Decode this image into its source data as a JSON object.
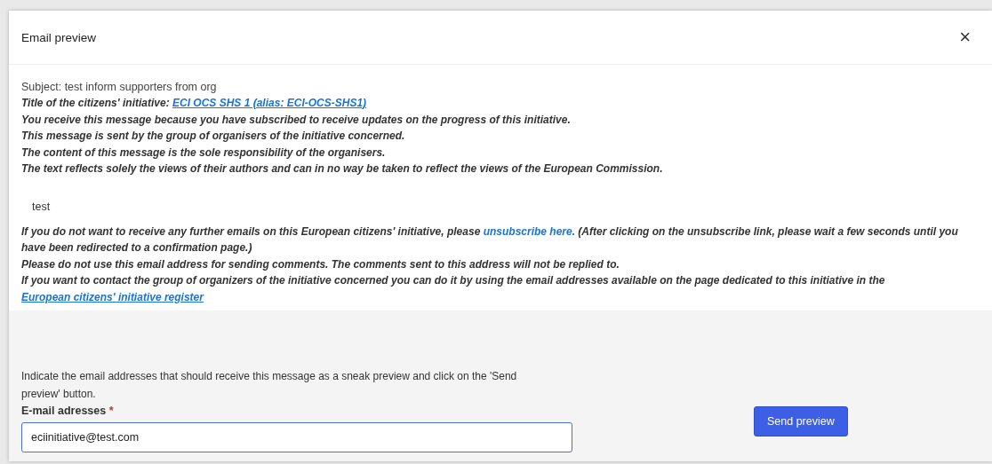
{
  "dialog": {
    "title": "Email preview",
    "close_icon": "×",
    "subject": "Subject: test inform supporters from org",
    "header_lines": [
      {
        "kind": "link",
        "text": "Title of the citizens' initiative: ",
        "link": "ECI OCS SHS 1 (alias: ECI-OCS-SHS1)",
        "underlined": true
      },
      {
        "kind": "text",
        "text": "You receive this message because you have subscribed to receive updates on the progress of this initiative."
      },
      {
        "kind": "text",
        "text": "This message is sent by the group of organisers of the initiative concerned."
      },
      {
        "kind": "text",
        "text": "The content of this message is the sole responsibility of the organisers."
      },
      {
        "kind": "text",
        "text": "The text reflects solely the views of their authors and can in no way be taken to reflect the views of the European Commission."
      }
    ],
    "body": "test",
    "footer_lines": [
      {
        "kind": "link",
        "text": "If you do not want to receive any further emails on this European citizens' initiative, please ",
        "link": "unsubscribe here.",
        "after": " (After clicking on the unsubscribe link, please wait a few seconds until you have been redirected to a confirmation page.)",
        "underlined": false
      },
      {
        "kind": "text",
        "text": "Please do not use this email address for sending comments. The comments sent to this address will not be replied to."
      },
      {
        "kind": "link",
        "text": "If you want to contact the group of organizers of the initiative concerned you can do it by using the email addresses available on the page dedicated to this initiative in the ",
        "link": "European citizens' initiative register",
        "underlined": true
      }
    ]
  },
  "preview_form": {
    "instructions": "Indicate the email addresses that should receive this message as a sneak preview and click on the 'Send preview' button.",
    "field_label": "E-mail adresses",
    "required_mark": "*",
    "value": "eciinitiative@test.com",
    "focused": true,
    "button": "Send preview"
  }
}
